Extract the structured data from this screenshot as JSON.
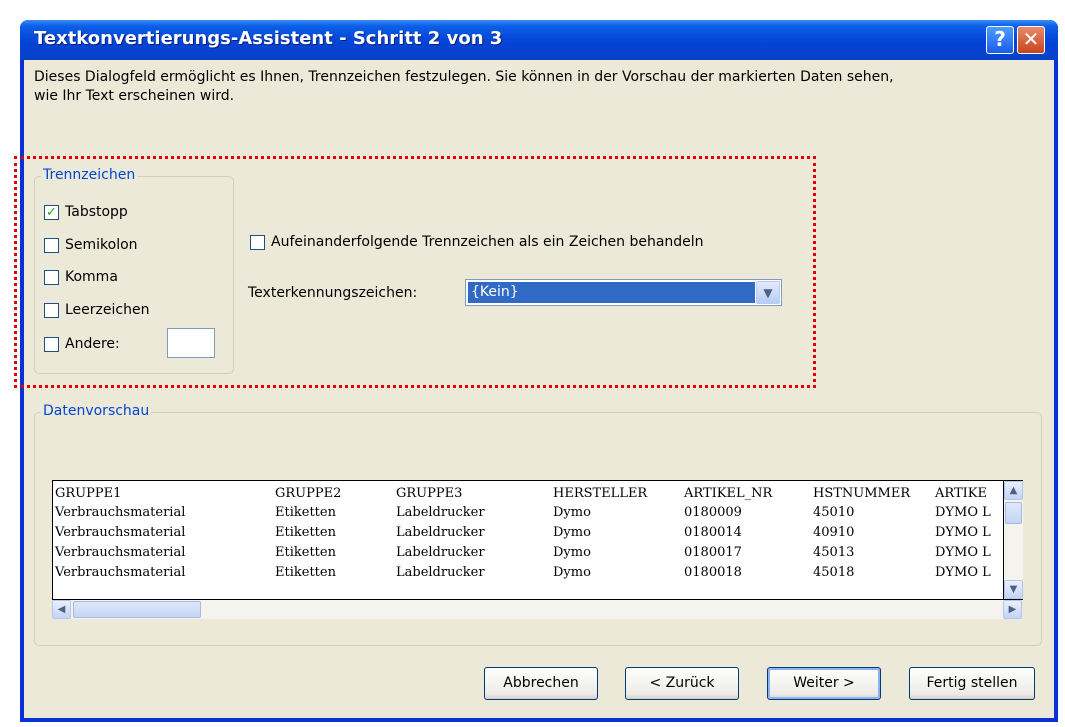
{
  "window": {
    "title": "Textkonvertierungs-Assistent - Schritt 2 von 3",
    "help_glyph": "?",
    "close_glyph": "✕"
  },
  "intro_text": "Dieses Dialogfeld ermöglicht es Ihnen, Trennzeichen festzulegen. Sie können in der Vorschau der markierten Daten sehen,\nwie Ihr Text erscheinen wird.",
  "delimiters": {
    "legend": "Trennzeichen",
    "items": [
      {
        "label": "Tabstopp",
        "checked": true,
        "mark": "✓"
      },
      {
        "label": "Semikolon",
        "checked": false,
        "mark": ""
      },
      {
        "label": "Komma",
        "checked": false,
        "mark": ""
      },
      {
        "label": "Leerzeichen",
        "checked": false,
        "mark": ""
      },
      {
        "label": "Andere:",
        "checked": false,
        "mark": ""
      }
    ],
    "other_value": ""
  },
  "options": {
    "consecutive_label": "Aufeinanderfolgende Trennzeichen als ein Zeichen behandeln",
    "consecutive_checked": false,
    "qualifier_label": "Texterkennungszeichen:",
    "qualifier_value": "{Kein}"
  },
  "preview": {
    "legend": "Datenvorschau",
    "columns": [
      "GRUPPE1",
      "GRUPPE2",
      "GRUPPE3",
      "HERSTELLER",
      "ARTIKEL_NR",
      "HSTNUMMER",
      "ARTIKE"
    ],
    "rows": [
      [
        "Verbrauchsmaterial",
        "Etiketten",
        "Labeldrucker",
        "Dymo",
        "0180009",
        "45010",
        "DYMO L"
      ],
      [
        "Verbrauchsmaterial",
        "Etiketten",
        "Labeldrucker",
        "Dymo",
        "0180014",
        "40910",
        "DYMO L"
      ],
      [
        "Verbrauchsmaterial",
        "Etiketten",
        "Labeldrucker",
        "Dymo",
        "0180017",
        "45013",
        "DYMO L"
      ],
      [
        "Verbrauchsmaterial",
        "Etiketten",
        "Labeldrucker",
        "Dymo",
        "0180018",
        "45018",
        "DYMO L"
      ]
    ]
  },
  "buttons": {
    "cancel": "Abbrechen",
    "back": "< Zurück",
    "next": "Weiter >",
    "finish": "Fertig stellen"
  },
  "colors": {
    "titlebar": "#0a5fe8",
    "dialog_bg": "#ece9d8",
    "legend_text": "#0046d5",
    "selection": "#316ac5",
    "highlight_border": "#e00000"
  }
}
